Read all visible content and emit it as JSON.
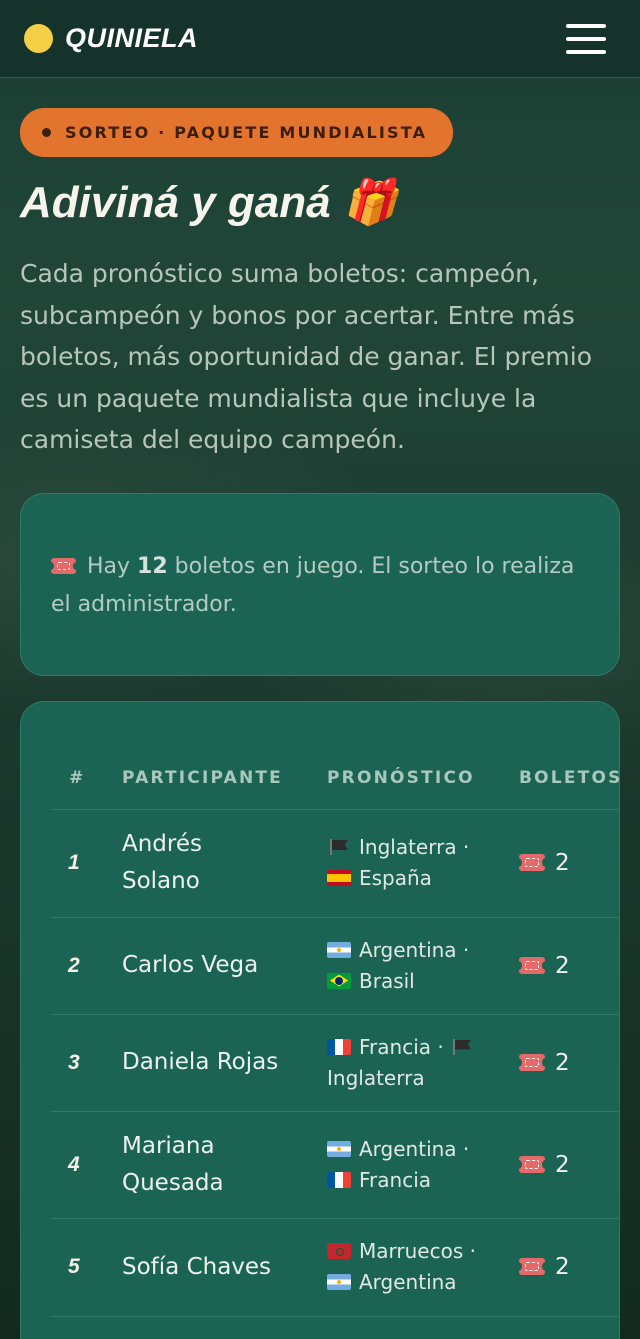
{
  "header": {
    "brand": "QUINIELA",
    "menu_icon": "hamburger-menu-icon"
  },
  "hero": {
    "badge": "SORTEO · PAQUETE MUNDIALISTA",
    "title": "Adiviná y ganá 🎁",
    "description": "Cada pronóstico suma boletos: campeón, subcampeón y bonos por acertar. Entre más boletos, más oportunidad de ganar. El premio es un paquete mundialista que incluye la camiseta del equipo campeón."
  },
  "info": {
    "prefix": "Hay",
    "count": "12",
    "suffix": "boletos en juego. El sorteo lo realiza el administrador.",
    "icon": "ticket-icon"
  },
  "table": {
    "headers": {
      "num": "#",
      "participant": "PARTICIPANTE",
      "forecast": "PRONÓSTICO",
      "tickets": "BOLETOS"
    },
    "rows": [
      {
        "num": "1",
        "name": "Andrés Solano",
        "champion": "Inglaterra",
        "champion_flag": "black-flag",
        "runner_up": "España",
        "runner_up_flag": "spain-flag",
        "tickets": "2"
      },
      {
        "num": "2",
        "name": "Carlos Vega",
        "champion": "Argentina",
        "champion_flag": "argentina-flag",
        "runner_up": "Brasil",
        "runner_up_flag": "brazil-flag",
        "tickets": "2"
      },
      {
        "num": "3",
        "name": "Daniela Rojas",
        "champion": "Francia",
        "champion_flag": "france-flag",
        "runner_up": "Inglaterra",
        "runner_up_flag": "black-flag",
        "tickets": "2"
      },
      {
        "num": "4",
        "name": "Mariana Quesada",
        "champion": "Argentina",
        "champion_flag": "argentina-flag",
        "runner_up": "Francia",
        "runner_up_flag": "france-flag",
        "tickets": "2"
      },
      {
        "num": "5",
        "name": "Sofía Chaves",
        "champion": "Marruecos",
        "champion_flag": "morocco-flag",
        "runner_up": "Argentina",
        "runner_up_flag": "argentina-flag",
        "tickets": "2"
      }
    ]
  }
}
